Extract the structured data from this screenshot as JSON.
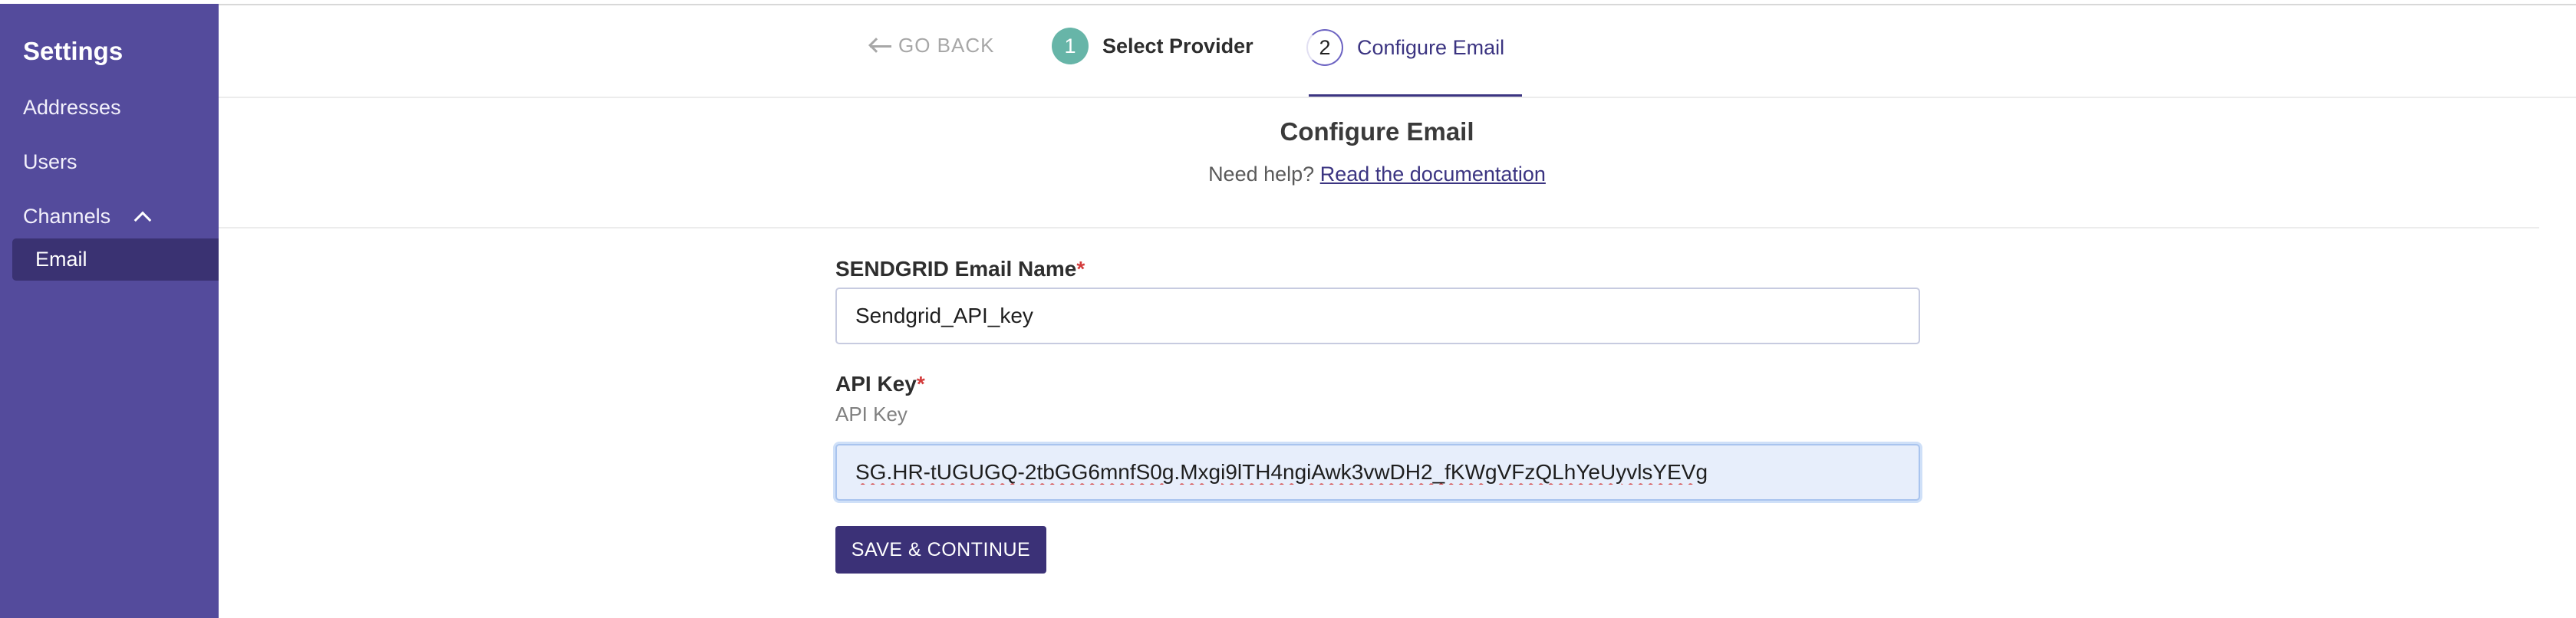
{
  "sidebar": {
    "title": "Settings",
    "items": [
      {
        "label": "Addresses"
      },
      {
        "label": "Users"
      },
      {
        "label": "Channels"
      }
    ],
    "subitems": [
      {
        "label": "Email",
        "active": true
      }
    ]
  },
  "stepper": {
    "go_back": "GO BACK",
    "steps": [
      {
        "number": "1",
        "label": "Select Provider",
        "status": "done"
      },
      {
        "number": "2",
        "label": "Configure Email",
        "status": "active"
      }
    ]
  },
  "form": {
    "title": "Configure Email",
    "help_prefix": "Need help?",
    "help_link": "Read the documentation",
    "fields": [
      {
        "label": "SENDGRID Email Name",
        "required_mark": "*",
        "value": "Sendgrid_API_key"
      },
      {
        "label": "API Key",
        "required_mark": "*",
        "sublabel": "API Key",
        "value": "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"
      }
    ],
    "save_label": "SAVE & CONTINUE"
  },
  "colors": {
    "sidebar_bg": "#544b9c",
    "accent": "#3b3481",
    "step_done": "#67b5a8",
    "required": "#d33b3b"
  }
}
